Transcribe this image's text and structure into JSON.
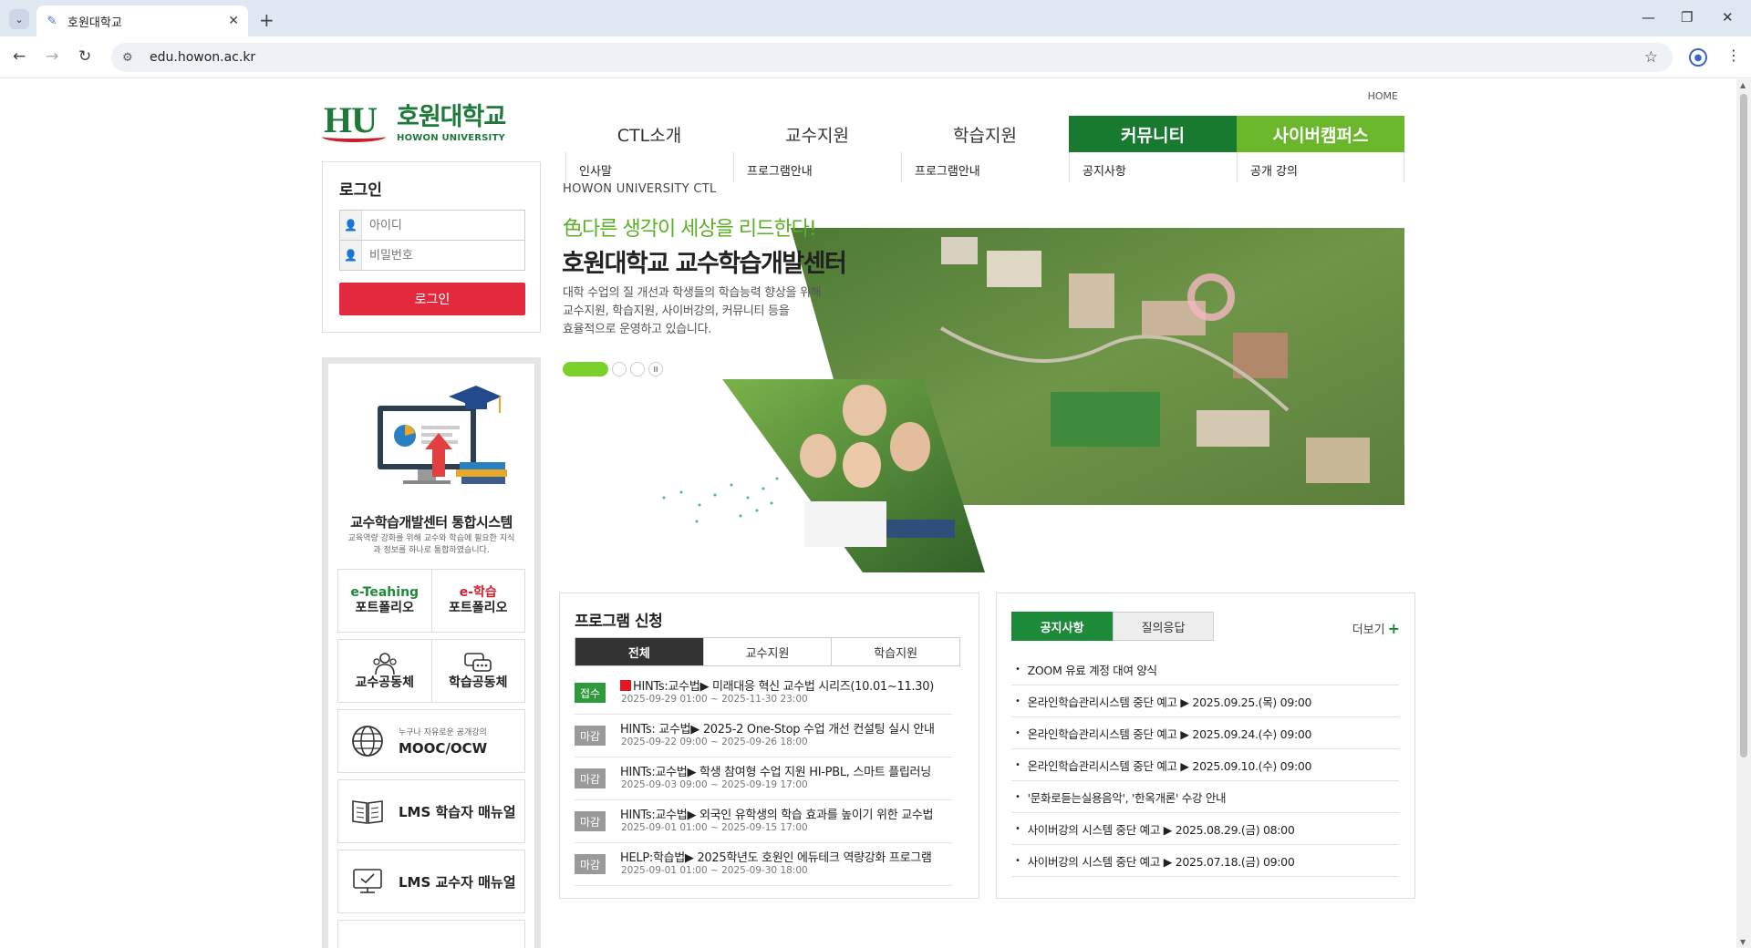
{
  "browser": {
    "tab_title": "호원대학교",
    "url": "edu.howon.ac.kr"
  },
  "header": {
    "home": "HOME",
    "logo_mark": "HU",
    "logo_kr": "호원대학교",
    "logo_en": "HOWON UNIVERSITY"
  },
  "gnb": [
    {
      "label": "CTL소개",
      "sub": "인사말"
    },
    {
      "label": "교수지원",
      "sub": "프로그램안내"
    },
    {
      "label": "학습지원",
      "sub": "프로그램안내"
    },
    {
      "label": "커뮤니티",
      "sub": "공지사항"
    },
    {
      "label": "사이버캠퍼스",
      "sub": "공개 강의"
    }
  ],
  "colors": {
    "community": "#187a2f",
    "cyber": "#6ab72b",
    "login_btn": "#e2293e",
    "notice_tab": "#1d8a3a"
  },
  "login": {
    "title": "로그인",
    "id_placeholder": "아이디",
    "pw_placeholder": "비밀번호",
    "button": "로그인"
  },
  "quick": {
    "title": "교수학습개발센터 통합시스템",
    "desc": "교육역량 강화를 위해 교수와 학습에 필요한 지식과 정보를 하나로 통합하였습니다.",
    "eteach_1": "e-Teahing",
    "eteach_2": "포트폴리오",
    "elearn_1": "e-학습",
    "elearn_2": "포트폴리오",
    "prof_comm": "교수공동체",
    "learn_comm": "학습공동체",
    "mooc_small": "누구나 자유로운 공개강의",
    "mooc": "MOOC/OCW",
    "lms_student": "LMS 학습자 매뉴얼",
    "lms_prof": "LMS 교수자 매뉴얼"
  },
  "hero": {
    "ctl": "HOWON UNIVERSITY CTL",
    "slogan": "色다른 생각이 세상을 리드한다!",
    "title": "호원대학교 교수학습개발센터",
    "desc1": "대학 수업의 질 개선과 학생들의 학습능력 향상을 위해",
    "desc2": "교수지원, 학습지원, 사이버강의, 커뮤니티 등을",
    "desc3": "효율적으로 운영하고 있습니다.",
    "pause": "II"
  },
  "program": {
    "title": "프로그램 신청",
    "tabs": [
      "전체",
      "교수지원",
      "학습지원"
    ],
    "items": [
      {
        "badge": "접수",
        "title": "HINTs:교수법▶ 미래대응 혁신 교수법 시리즈(10.01~11.30)",
        "date": "2025-09-29 01:00 ~ 2025-11-30 23:00"
      },
      {
        "badge": "마감",
        "title": "HINTs: 교수법▶ 2025-2 One-Stop 수업 개선 컨설팅 실시 안내",
        "date": "2025-09-22 09:00 ~ 2025-09-26 18:00"
      },
      {
        "badge": "마감",
        "title": "HINTs:교수법▶ 학생 참여형 수업 지원 HI-PBL, 스마트 플립러닝",
        "date": "2025-09-03 09:00 ~ 2025-09-19 17:00"
      },
      {
        "badge": "마감",
        "title": "HINTs:교수법▶ 외국인 유학생의 학습 효과를 높이기 위한 교수법",
        "date": "2025-09-01 01:00 ~ 2025-09-15 17:00"
      },
      {
        "badge": "마감",
        "title": "HELP:학습법▶ 2025학년도 호원인 에듀테크 역량강화 프로그램",
        "date": "2025-09-01 01:00 ~ 2025-09-30 18:00"
      }
    ]
  },
  "notice": {
    "tabs": [
      "공지사항",
      "질의응답"
    ],
    "more": "더보기",
    "items": [
      "ZOOM 유료 계정 대여 양식",
      "온라인학습관리시스템 중단 예고 ▶ 2025.09.25.(목) 09:00",
      "온라인학습관리시스템 중단 예고 ▶ 2025.09.24.(수) 09:00",
      "온라인학습관리시스템 중단 예고 ▶ 2025.09.10.(수) 09:00",
      "'문화로듣는실용음악', '한옥개론' 수강 안내",
      "사이버강의 시스템 중단 예고 ▶ 2025.08.29.(금) 08:00",
      "사이버강의 시스템 중단 예고 ▶ 2025.07.18.(금) 09:00"
    ]
  }
}
